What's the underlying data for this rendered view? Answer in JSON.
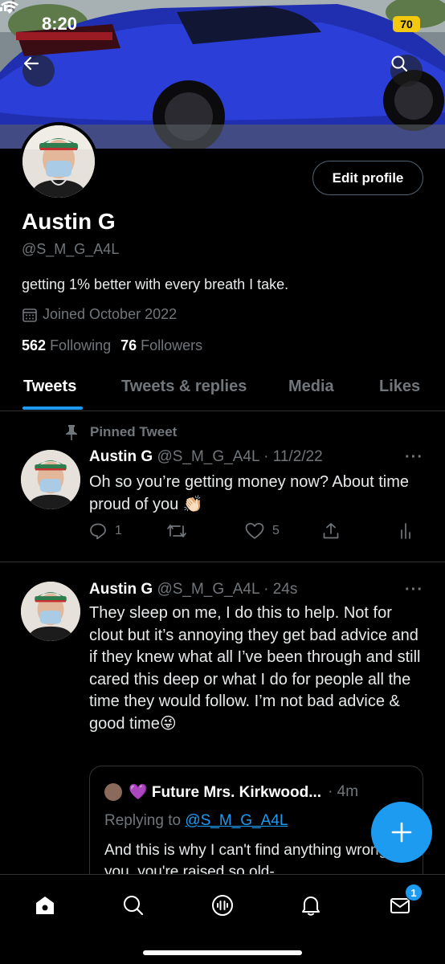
{
  "status_bar": {
    "time": "8:20",
    "battery": "70"
  },
  "profile": {
    "name": "Austin G",
    "handle": "@S_M_G_A4L",
    "bio": "getting 1% better with every breath I take.",
    "joined": "Joined October 2022",
    "following_count": "562",
    "following_label": "Following",
    "followers_count": "76",
    "followers_label": "Followers",
    "edit_label": "Edit profile"
  },
  "tabs": [
    {
      "label": "Tweets",
      "active": true
    },
    {
      "label": "Tweets & replies",
      "active": false
    },
    {
      "label": "Media",
      "active": false
    },
    {
      "label": "Likes",
      "active": false
    }
  ],
  "tweets": [
    {
      "pinned_label": "Pinned Tweet",
      "name": "Austin G",
      "meta": "@S_M_G_A4L · 11/2/22",
      "body": "Oh so you’re getting money now? About time proud of you 👏🏻",
      "replies": "1",
      "likes": "5"
    },
    {
      "name": "Austin G",
      "meta": "@S_M_G_A4L · 24s",
      "body": "They sleep on me, I do this to help. Not for clout but it’s annoying they get bad advice and if they knew what all I’ve been through and still cared this deep or what I do for people all the time they would follow. I’m not bad advice & good time😜",
      "quote": {
        "name": "💜 Future Mrs. Kirkwood...",
        "meta": " · 4m",
        "reply_prefix": "Replying to ",
        "reply_handle": "@S_M_G_A4L",
        "body": "And this is why I can't find anything wrong with you, you're raised so old-"
      }
    }
  ],
  "notifications_badge": "1",
  "colors": {
    "accent": "#1d9bf0",
    "background": "#000000",
    "muted": "#71767b",
    "border": "#2f3336"
  },
  "icons": [
    "back-arrow-icon",
    "search-icon",
    "calendar-icon",
    "pin-icon",
    "reply-icon",
    "retweet-icon",
    "heart-icon",
    "share-icon",
    "analytics-icon",
    "plus-icon",
    "home-icon",
    "explore-icon",
    "spaces-icon",
    "bell-icon",
    "mail-icon"
  ]
}
